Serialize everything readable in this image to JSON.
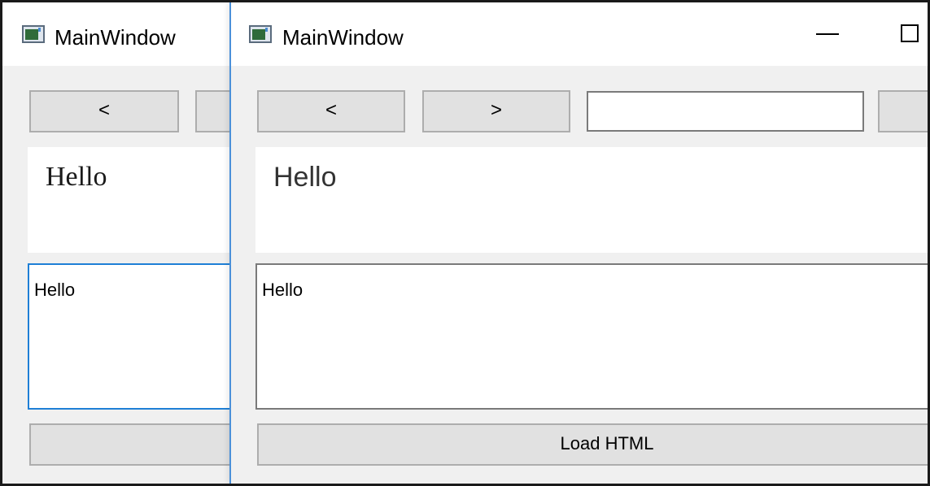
{
  "windows": {
    "back": {
      "title": "MainWindow",
      "back_button": "<",
      "web_text": "Hello",
      "editor_text": "Hello"
    },
    "front": {
      "title": "MainWindow",
      "back_button": "<",
      "forward_button": ">",
      "url_value": "",
      "web_text": "Hello",
      "editor_text": "Hello",
      "load_button": "Load HTML"
    }
  },
  "icons": {
    "app": "window-app-icon",
    "minimize": "minimize-icon",
    "maximize": "maximize-icon"
  },
  "colors": {
    "focus_border": "#1e7fd6",
    "active_window_edge": "#4a90d9",
    "button_bg": "#e1e1e1",
    "window_bg": "#f0f0f0"
  }
}
